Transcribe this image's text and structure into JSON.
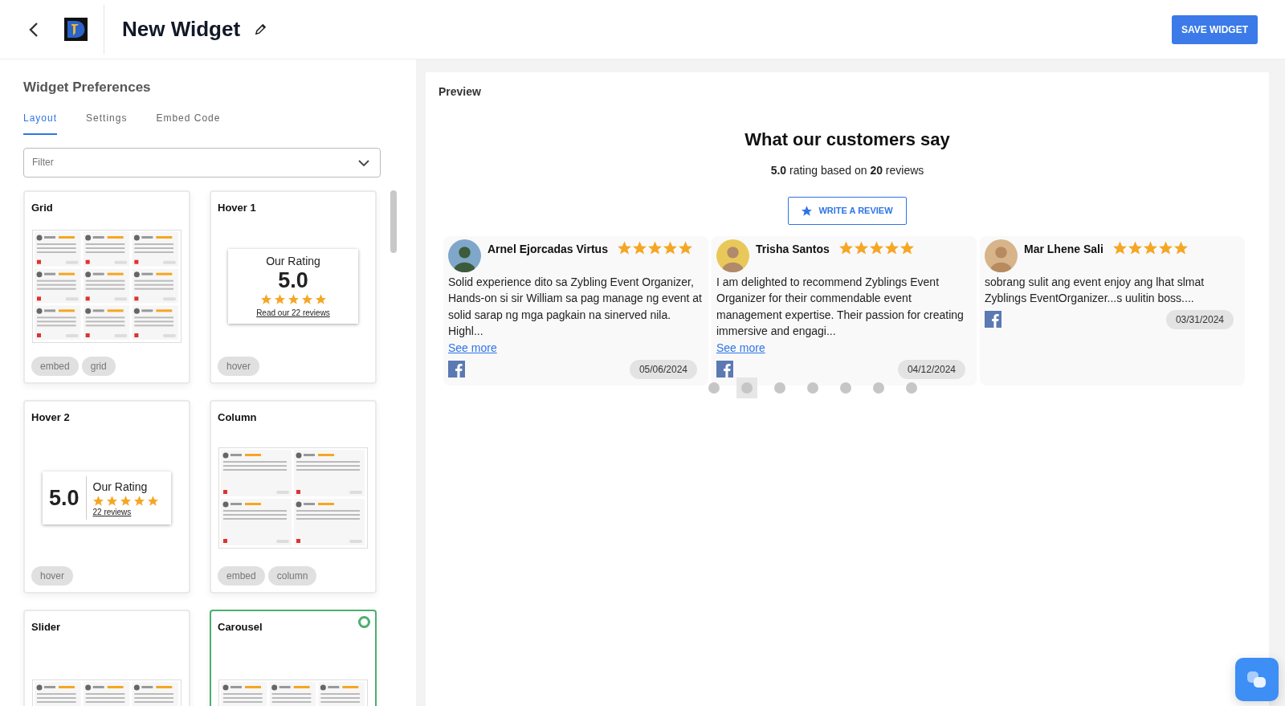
{
  "header": {
    "title": "New Widget",
    "save_button": "SAVE WIDGET"
  },
  "preferences": {
    "title": "Widget Preferences",
    "tabs": [
      {
        "label": "Layout",
        "selected": true
      },
      {
        "label": "Settings",
        "selected": false
      },
      {
        "label": "Embed Code",
        "selected": false
      }
    ],
    "filter": {
      "placeholder": "Filter"
    },
    "layouts": [
      {
        "title": "Grid",
        "kind": "grid",
        "tags": [
          "embed",
          "grid"
        ],
        "selected": false
      },
      {
        "title": "Hover 1",
        "kind": "hover1",
        "rating_label": "Our Rating",
        "rating": "5.0",
        "stars": 5,
        "link": "Read our 22 reviews",
        "tags": [
          "hover"
        ],
        "selected": false
      },
      {
        "title": "Hover 2",
        "kind": "hover2",
        "rating_label": "Our Rating",
        "rating": "5.0",
        "stars": 5,
        "link": "22 reviews",
        "tags": [
          "hover"
        ],
        "selected": false
      },
      {
        "title": "Column",
        "kind": "column",
        "tags": [
          "embed",
          "column"
        ],
        "selected": false
      },
      {
        "title": "Slider",
        "kind": "slider",
        "selected": false
      },
      {
        "title": "Carousel",
        "kind": "carousel",
        "selected": true
      }
    ]
  },
  "preview": {
    "title": "Preview",
    "heading": "What our customers say",
    "summary": "**5.0** rating based on **20** reviews",
    "write_button": "WRITE A REVIEW",
    "reviews": [
      {
        "name": "Arnel Ejorcadas Virtus",
        "stars": 5,
        "text": "Solid experience dito sa Zybling Event Organizer, Hands-on si sir William sa pag manage ng event at solid sarap ng mga pagkain na sinerved nila. Highl...",
        "see_more": "See more",
        "date": "05/06/2024"
      },
      {
        "name": "Trisha Santos",
        "stars": 5,
        "text": "I am delighted to recommend Zyblings Event Organizer for their commendable event management expertise. Their passion for creating immersive and engagi...",
        "see_more": "See more",
        "date": "04/12/2024"
      },
      {
        "name": "Mar Lhene Sali",
        "stars": 5,
        "text": "sobrang sulit ang event enjoy ang lhat slmat Zyblings EventOrganizer...s uulitin boss....",
        "date": "03/31/2024"
      }
    ],
    "dots": [
      {
        "selected": false
      },
      {
        "selected": true
      },
      {
        "selected": false
      },
      {
        "selected": false
      },
      {
        "selected": false
      },
      {
        "selected": false
      },
      {
        "selected": false
      }
    ]
  }
}
